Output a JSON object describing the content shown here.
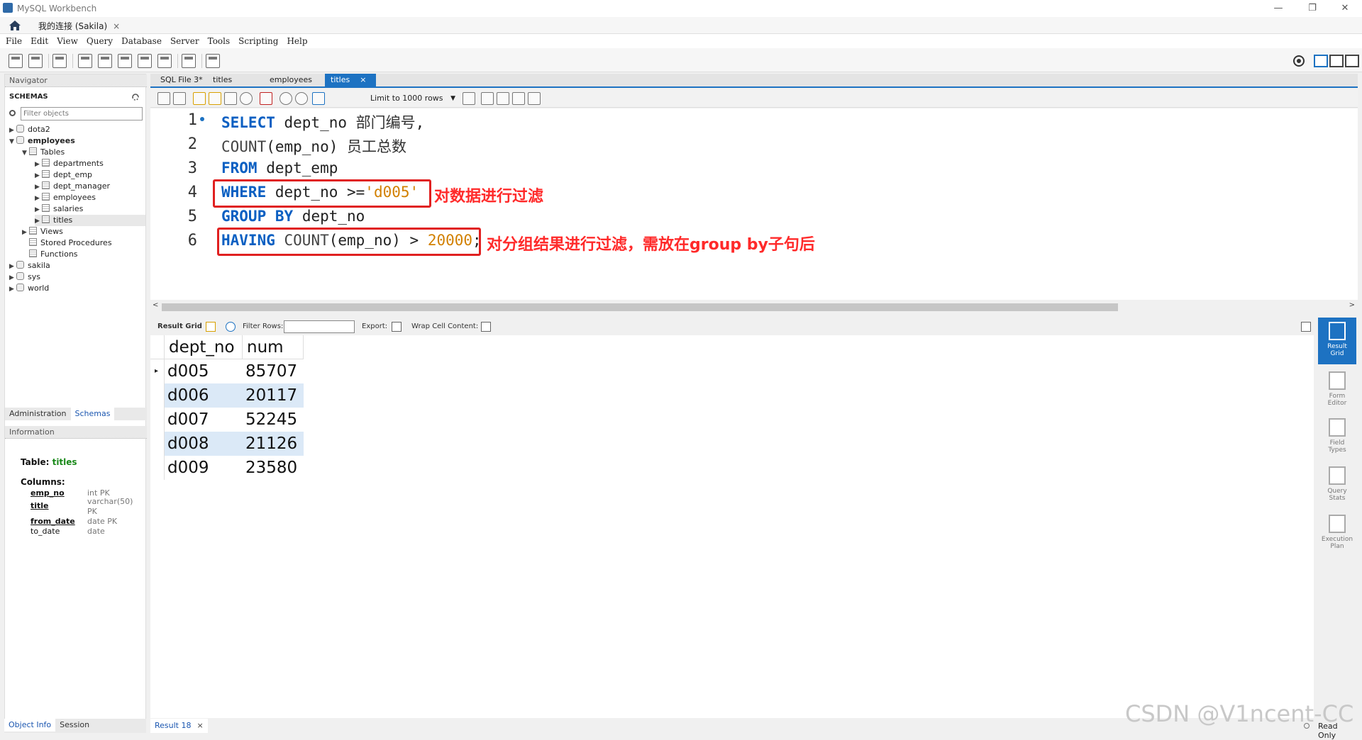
{
  "window": {
    "title": "MySQL Workbench",
    "controls": [
      "—",
      "❐",
      "✕"
    ]
  },
  "connection_tab": {
    "label": "我的连接 (Sakila)",
    "close": "×"
  },
  "menu": [
    "File",
    "Edit",
    "View",
    "Query",
    "Database",
    "Server",
    "Tools",
    "Scripting",
    "Help"
  ],
  "navigator": {
    "header": "Navigator",
    "schemas_label": "SCHEMAS",
    "filter_placeholder": "Filter objects",
    "tree": [
      {
        "label": "dota2"
      },
      {
        "label": "employees"
      },
      {
        "label": "Tables"
      },
      {
        "label": "departments"
      },
      {
        "label": "dept_emp"
      },
      {
        "label": "dept_manager"
      },
      {
        "label": "employees"
      },
      {
        "label": "salaries"
      },
      {
        "label": "titles"
      },
      {
        "label": "Views"
      },
      {
        "label": "Stored Procedures"
      },
      {
        "label": "Functions"
      },
      {
        "label": "sakila"
      },
      {
        "label": "sys"
      },
      {
        "label": "world"
      }
    ],
    "tabs": [
      "Administration",
      "Schemas"
    ]
  },
  "information": {
    "header": "Information",
    "table_label": "Table:",
    "table_name": "titles",
    "columns_label": "Columns:",
    "columns": [
      {
        "name": "emp_no",
        "type": "int PK"
      },
      {
        "name": "title",
        "type": "varchar(50)",
        "type2": "PK"
      },
      {
        "name": "from_date",
        "type": "date PK"
      },
      {
        "name": "to_date",
        "type": "date"
      }
    ],
    "bottom_tabs": [
      "Object Info",
      "Session"
    ]
  },
  "editor_tabs": [
    "SQL File 3*",
    "titles",
    "employees",
    "titles"
  ],
  "editor_tab_close": "×",
  "limit_label": "Limit to 1000 rows",
  "sql": {
    "line1": {
      "n": "1",
      "kw": "SELECT",
      "rest": " dept_no ",
      "cn": "部门编号",
      "tail": ","
    },
    "line2": {
      "n": "2",
      "fn": "COUNT",
      "rest": "(emp_no) ",
      "cn": "员工总数"
    },
    "line3": {
      "n": "3",
      "kw": "FROM",
      "rest": " dept_emp"
    },
    "line4": {
      "n": "4",
      "kw": "WHERE",
      "rest": " dept_no >=",
      "str": "'d005'"
    },
    "line5": {
      "n": "5",
      "kw": "GROUP",
      "kw2": "BY",
      "rest": " dept_no"
    },
    "line6": {
      "n": "6",
      "kw": "HAVING",
      "fn": "COUNT",
      "rest": "(emp_no) > ",
      "num": "20000",
      "tail": ";"
    }
  },
  "annotations": {
    "where": "对数据进行过滤",
    "having": "对分组结果进行过滤，需放在group by子句后"
  },
  "result_toolbar": {
    "result_grid": "Result Grid",
    "filter_rows": "Filter Rows:",
    "export": "Export:",
    "wrap": "Wrap Cell Content:"
  },
  "result": {
    "columns": [
      "dept_no",
      "num"
    ],
    "rows": [
      [
        "d005",
        "85707"
      ],
      [
        "d006",
        "20117"
      ],
      [
        "d007",
        "52245"
      ],
      [
        "d008",
        "21126"
      ],
      [
        "d009",
        "23580"
      ]
    ]
  },
  "side_panel": [
    {
      "l1": "Result",
      "l2": "Grid"
    },
    {
      "l1": "Form",
      "l2": "Editor"
    },
    {
      "l1": "Field",
      "l2": "Types"
    },
    {
      "l1": "Query",
      "l2": "Stats"
    },
    {
      "l1": "Execution",
      "l2": "Plan"
    }
  ],
  "bottom": {
    "result_tab": "Result 18",
    "status": "Read Only"
  },
  "watermark": "CSDN @V1ncent-CC",
  "colors": {
    "accent": "#1d72c2",
    "annotation": "#ff2a2a",
    "row_alt": "#dbe9f7"
  }
}
